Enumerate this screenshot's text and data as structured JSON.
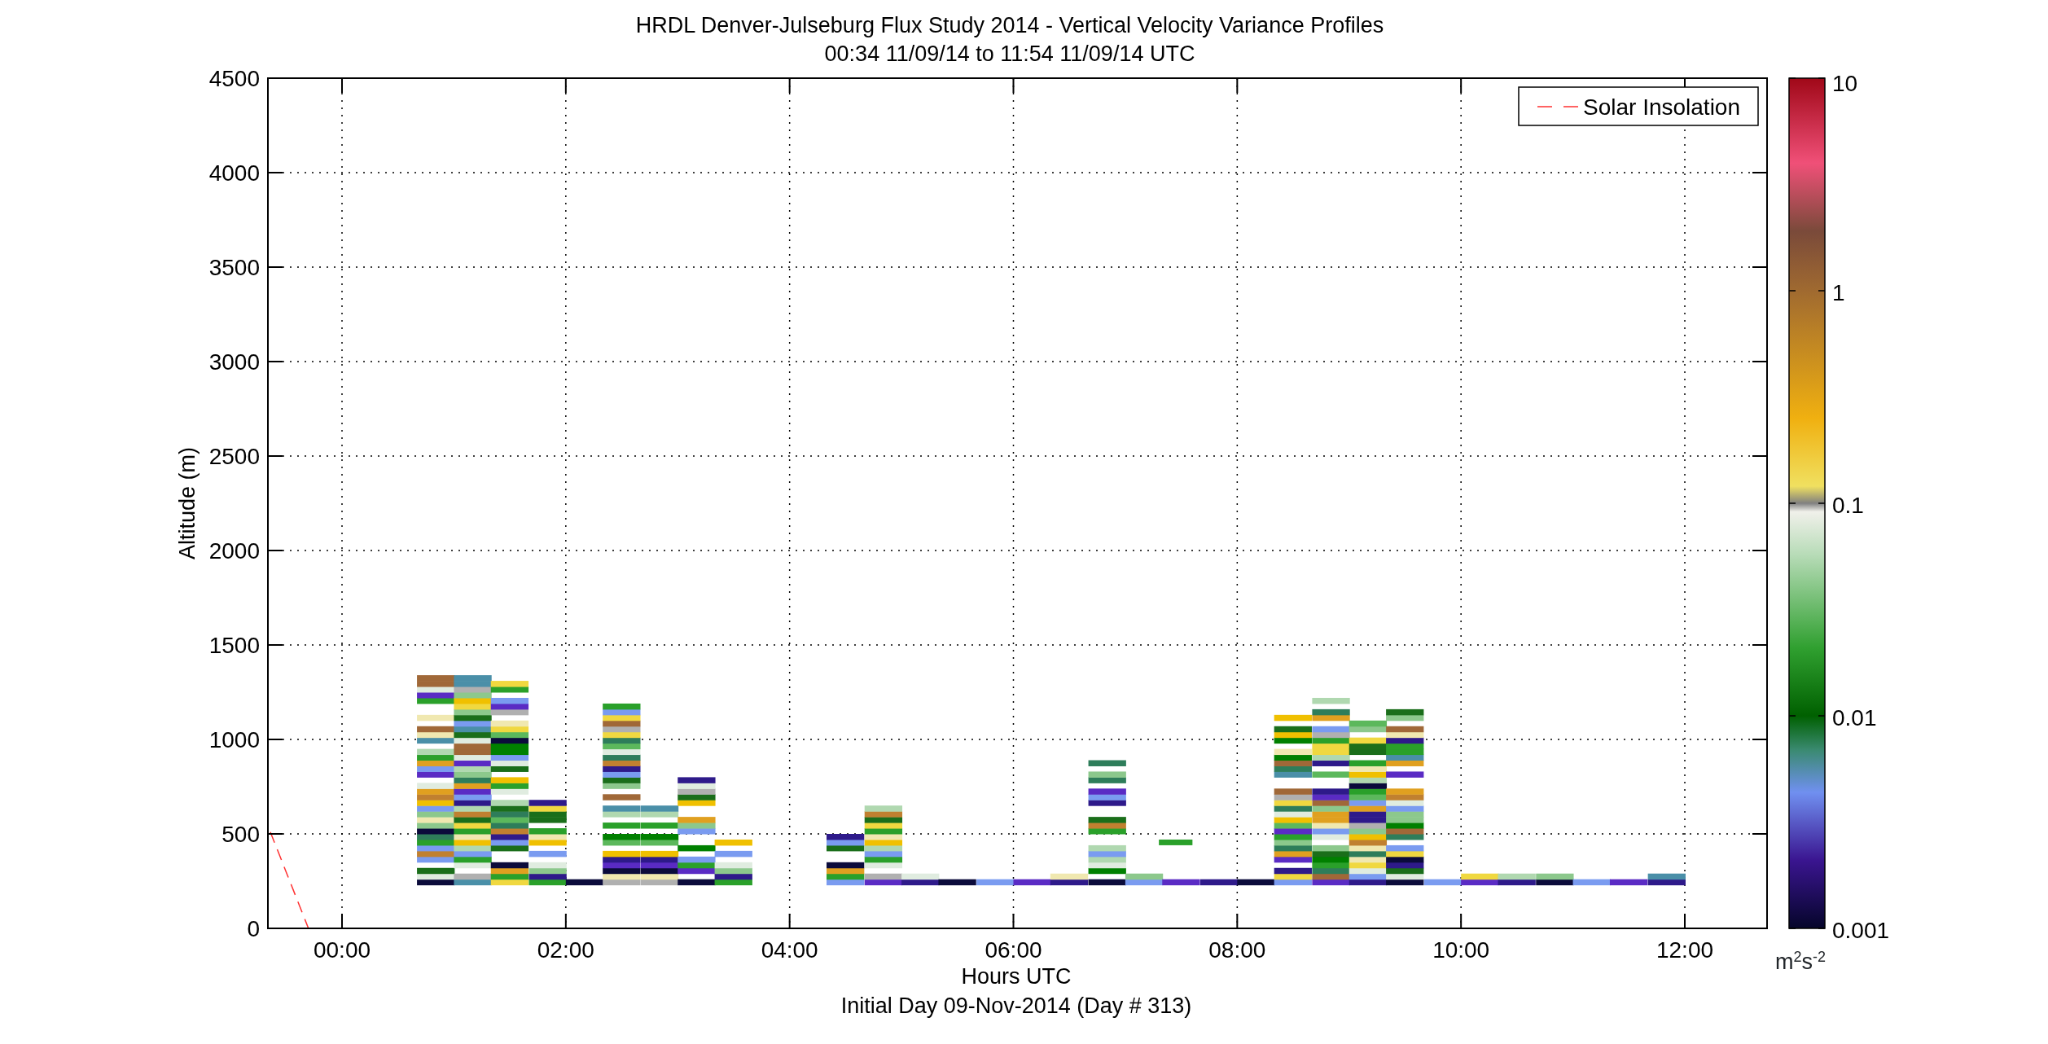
{
  "figure": {
    "title_lines": [
      "HRDL Denver-Julseburg Flux Study 2014 - Vertical Velocity Variance Profiles",
      "00:34 11/09/14 to 11:54 11/09/14  UTC"
    ],
    "ylabel": "Altitude (m)",
    "yticks": [
      "4500",
      "4000",
      "3500",
      "3000",
      "2500",
      "2000",
      "1500",
      "1000",
      "500",
      "0"
    ],
    "xticks": [
      "00:00",
      "02:00",
      "04:00",
      "06:00",
      "08:00",
      "10:00",
      "12:00"
    ],
    "xlabel": "Hours UTC",
    "caption": "Initial Day 09-Nov-2014 (Day # 313)",
    "legend": {
      "label": "Solar Insolation"
    }
  },
  "colorbar": {
    "ticks": [
      "10",
      "1",
      "0.1",
      "0.01",
      "0.001"
    ],
    "unit": "m$^{2}$s$^{-2}$"
  }
}
